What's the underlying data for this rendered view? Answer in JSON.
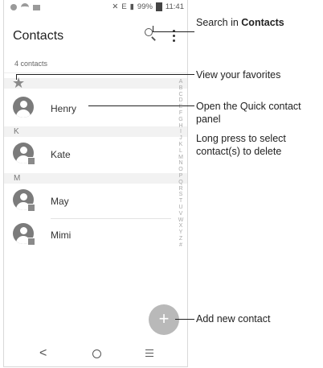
{
  "status_bar": {
    "signal_text": "E",
    "battery": "99%",
    "time": "11:41"
  },
  "app_bar": {
    "title": "Contacts"
  },
  "list": {
    "count_label": "4 contacts",
    "favorites_icon": "star-icon",
    "sections": [
      {
        "label": "K"
      },
      {
        "label": "M"
      }
    ],
    "contacts": [
      {
        "name": "Henry"
      },
      {
        "name": "Kate"
      },
      {
        "name": "May"
      },
      {
        "name": "Mimi"
      }
    ],
    "index_letters": "A B C D E F G H I J K L M N O P Q R S T U V W X Y Z #"
  },
  "fab": {
    "symbol": "+"
  },
  "nav_bar": {
    "back": "<"
  },
  "callouts": {
    "search_prefix": "Search in ",
    "search_bold": "Contacts",
    "favorites": "View your favorites",
    "quick_contact": "Open the Quick contact panel",
    "long_press": "Long press to select contact(s) to delete",
    "add_contact": "Add new contact"
  }
}
